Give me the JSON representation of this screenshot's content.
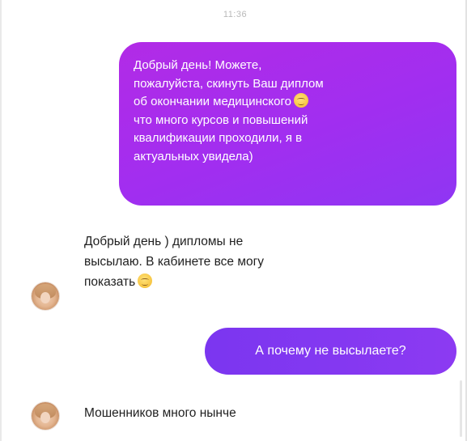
{
  "chat": {
    "timestamp": "11:36",
    "messages": [
      {
        "direction": "outgoing",
        "lines": [
          "Добрый день! Можете,",
          "пожалуйста, скинуть Ваш диплом",
          "об окончании медицинского",
          "что много курсов и повышений",
          "квалификации проходили, я в",
          "актуальных увидела)"
        ],
        "emoji_after_line": 3,
        "emoji": "relieved-face"
      },
      {
        "direction": "incoming",
        "lines": [
          "Добрый день ) дипломы не",
          "высылаю. В кабинете все могу",
          "показать"
        ],
        "emoji_after_line": 3,
        "emoji": "relieved-face"
      },
      {
        "direction": "outgoing",
        "text": "А почему не высылаете?"
      },
      {
        "direction": "incoming",
        "text": "Мошенников много нынче"
      }
    ],
    "colors": {
      "outgoing_bubble": "#a12ef0",
      "outgoing_bubble_alt": "#8c3af2",
      "incoming_text": "#1f1f1f",
      "timestamp": "#b9b9b9"
    }
  }
}
